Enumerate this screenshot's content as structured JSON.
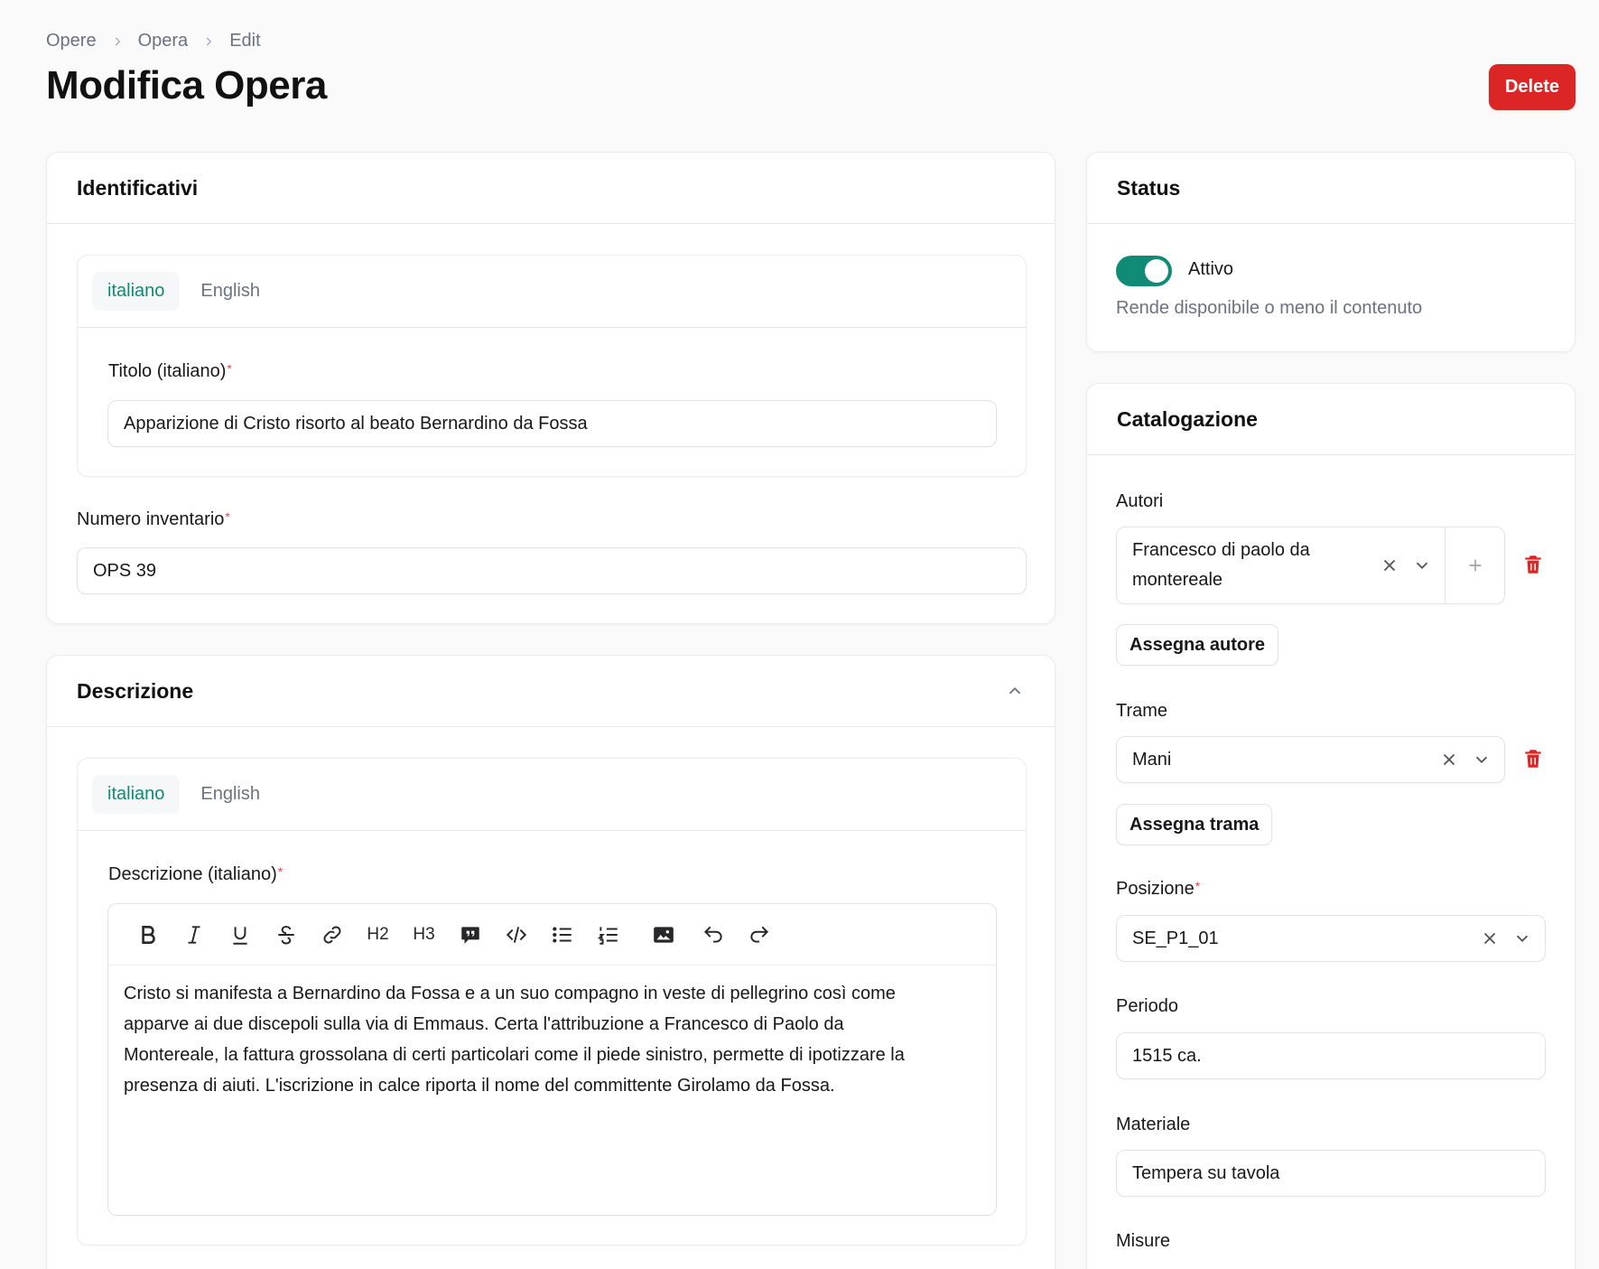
{
  "breadcrumb": [
    "Opere",
    "Opera",
    "Edit"
  ],
  "page_title": "Modifica Opera",
  "delete_label": "Delete",
  "identificativi": {
    "title": "Identificativi",
    "tabs": [
      "italiano",
      "English"
    ],
    "titolo_label": "Titolo (italiano)",
    "titolo_value": "Apparizione di Cristo risorto al beato Bernardino da Fossa",
    "inventario_label": "Numero inventario",
    "inventario_value": "OPS 39"
  },
  "descrizione": {
    "title": "Descrizione",
    "tabs": [
      "italiano",
      "English"
    ],
    "label": "Descrizione (italiano)",
    "lines": [
      "Cristo si manifesta a Bernardino da Fossa e a un suo compagno in veste di pellegrino così come",
      "apparve ai due discepoli sulla via di Emmaus. Certa l'attribuzione a Francesco di Paolo da",
      "Montereale, la fattura grossolana di certi particolari come il piede sinistro, permette di ipotizzare la",
      "presenza di aiuti. L'iscrizione in calce riporta il nome del committente Girolamo da Fossa."
    ],
    "toolbar": [
      "bold-icon",
      "italic-icon",
      "underline-icon",
      "strikethrough-icon",
      "link-icon",
      "heading2-icon",
      "heading3-icon",
      "quote-icon",
      "code-icon",
      "bullet-list-icon",
      "ordered-list-icon",
      "image-icon",
      "undo-icon",
      "redo-icon"
    ],
    "toolbar_h2": "H2",
    "toolbar_h3": "H3"
  },
  "status": {
    "title": "Status",
    "toggle_label": "Attivo",
    "toggle_on": true,
    "help": "Rende disponibile o meno il contenuto"
  },
  "catalogazione": {
    "title": "Catalogazione",
    "autori_label": "Autori",
    "autori_value_1": "Francesco di paolo da",
    "autori_value_2": "montereale",
    "assegna_autore": "Assegna autore",
    "trame_label": "Trame",
    "trame_value": "Mani",
    "assegna_trama": "Assegna trama",
    "posizione_label": "Posizione",
    "posizione_value": "SE_P1_01",
    "periodo_label": "Periodo",
    "periodo_value": "1515 ca.",
    "materiale_label": "Materiale",
    "materiale_value": "Tempera su tavola",
    "misure_label": "Misure"
  },
  "colors": {
    "accent": "#0f8b76",
    "danger": "#dc2626"
  }
}
